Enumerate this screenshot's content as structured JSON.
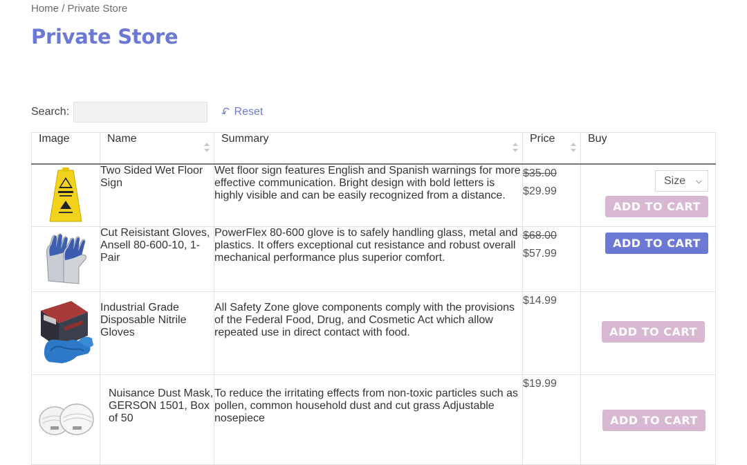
{
  "breadcrumb": {
    "home": "Home",
    "separator": "/",
    "current": "Private Store"
  },
  "page_title": "Private Store",
  "search": {
    "label": "Search:",
    "value": "",
    "placeholder": ""
  },
  "reset_label": "Reset",
  "table": {
    "headers": {
      "image": "Image",
      "name": "Name",
      "summary": "Summary",
      "price": "Price",
      "buy": "Buy"
    },
    "rows": [
      {
        "name": "Two Sided Wet Floor Sign",
        "summary": "Wet floor sign features English and Spanish warnings for more effective communication. Bright design with bold letters is highly visible and can be easily recognized from a distance.",
        "old_price": "$35.00",
        "price": "$29.99",
        "size_select": "Size",
        "cart_label": "ADD TO CART",
        "cart_state": "disabled",
        "image_icon": "wet-floor-sign"
      },
      {
        "name": "Cut Reisistant Gloves, Ansell 80-600-10, 1-Pair",
        "summary": "PowerFlex 80-600 glove is to safely handling glass, metal and plastics. It offers exceptional cut resistance and robust overall mechanical performance plus superior comfort.",
        "old_price": "$68.00",
        "price": "$57.99",
        "cart_label": "ADD TO CART",
        "cart_state": "active",
        "image_icon": "cut-resistant-gloves"
      },
      {
        "name": "Industrial Grade Disposable Nitrile Gloves",
        "summary": "All Safety Zone glove components comply with the provisions of the Federal Food, Drug, and Cosmetic Act which allow repeated use in direct contact with food.",
        "price": "$14.99",
        "cart_label": "ADD TO CART",
        "cart_state": "disabled",
        "image_icon": "nitrile-gloves-box"
      },
      {
        "name": "Nuisance Dust Mask, GERSON 1501, Box of 50",
        "summary": "To reduce the irritating effects from non-toxic particles such as pollen, common household dust and cut grass Adjustable nosepiece",
        "price": "$19.99",
        "cart_label": "ADD TO CART",
        "cart_state": "disabled",
        "image_icon": "dust-mask"
      }
    ]
  },
  "colors": {
    "accent": "#6b79d4",
    "cart_disabled": "#d7b7d2",
    "cart_active": "#6b79d4"
  }
}
